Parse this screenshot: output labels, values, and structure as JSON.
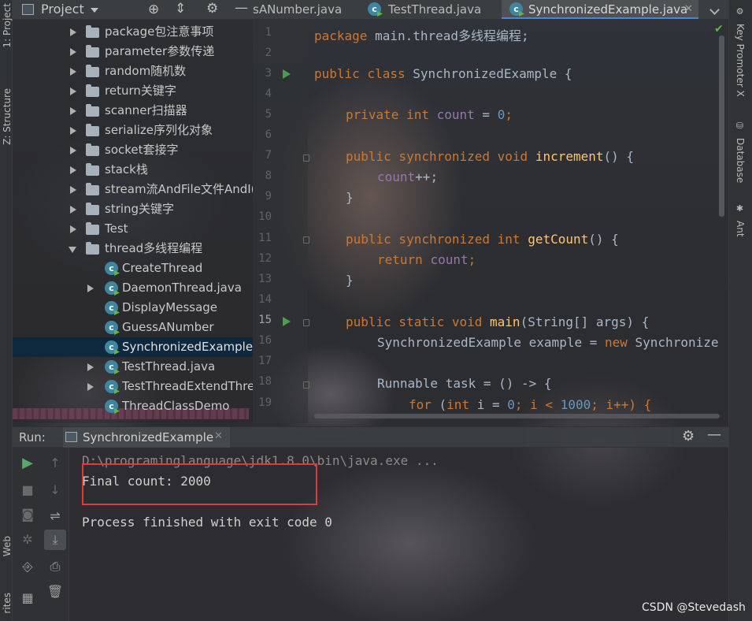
{
  "left_strip": {
    "project_label": "1: Project",
    "structure_label": "Z: Structure",
    "web_label": "Web",
    "favorites_label": "rites"
  },
  "right_strip": {
    "key_promoter_label": "Key Promoter X",
    "database_label": "Database",
    "ant_label": "Ant"
  },
  "project_header": {
    "title": "Project"
  },
  "tabs": [
    {
      "label": "sANumber.java",
      "active": false
    },
    {
      "label": "TestThread.java",
      "active": false
    },
    {
      "label": "SynchronizedExample.java",
      "active": true
    }
  ],
  "tree": {
    "items": [
      {
        "label": "package包注意事项",
        "kind": "folder"
      },
      {
        "label": "parameter参数传递",
        "kind": "folder"
      },
      {
        "label": "random随机数",
        "kind": "folder"
      },
      {
        "label": "return关键字",
        "kind": "folder"
      },
      {
        "label": "scanner扫描器",
        "kind": "folder"
      },
      {
        "label": "serialize序列化对象",
        "kind": "folder"
      },
      {
        "label": "socket套接字",
        "kind": "folder"
      },
      {
        "label": "stack栈",
        "kind": "folder"
      },
      {
        "label": "stream流AndFile文件AndI(",
        "kind": "folder"
      },
      {
        "label": "string关键字",
        "kind": "folder"
      },
      {
        "label": "Test",
        "kind": "folder"
      },
      {
        "label": "thread多线程编程",
        "kind": "folder-open"
      },
      {
        "label": "CreateThread",
        "kind": "class"
      },
      {
        "label": "DaemonThread.java",
        "kind": "class-file"
      },
      {
        "label": "DisplayMessage",
        "kind": "class"
      },
      {
        "label": "GuessANumber",
        "kind": "class"
      },
      {
        "label": "SynchronizedExample",
        "kind": "class",
        "selected": true
      },
      {
        "label": "TestThread.java",
        "kind": "class-file"
      },
      {
        "label": "TestThreadExtendThre",
        "kind": "class-file"
      },
      {
        "label": "ThreadClassDemo",
        "kind": "class"
      }
    ]
  },
  "editor": {
    "line_numbers": [
      "1",
      "2",
      "3",
      "4",
      "5",
      "6",
      "7",
      "8",
      "9",
      "10",
      "11",
      "12",
      "13",
      "14",
      "15",
      "16",
      "17",
      "18",
      "19"
    ],
    "current_line": "15",
    "code": {
      "l1_kw": "package",
      "l1_rest": " main.thread多线程编程;",
      "l3_kw": "public class",
      "l3_rest": " SynchronizedExample {",
      "l5_kw": "private int",
      "l5_field": "count",
      "l5_eq": " = ",
      "l5_num": "0",
      "l5_end": ";",
      "l7_kw": "public synchronized void",
      "l7_fn": "increment",
      "l7_end": "() {",
      "l8_field": "count",
      "l8_end": "++;",
      "l9": "}",
      "l11_kw": "public synchronized int",
      "l11_fn": "getCount",
      "l11_end": "() {",
      "l12_kw": "return",
      "l12_field": "count",
      "l12_end": ";",
      "l13": "}",
      "l15_kw": "public static void",
      "l15_fn": "main",
      "l15_end": "(String[] args) {",
      "l16_a": "SynchronizedExample example = ",
      "l16_kw": "new",
      "l16_b": " Synchronize",
      "l18_a": "Runnable task = () -> {",
      "l19_kw": "for",
      "l19_a": " (",
      "l19_kw2": "int",
      "l19_b": " i = ",
      "l19_n1": "0",
      "l19_c": "; i < ",
      "l19_n2": "1000",
      "l19_d": "; i++) {"
    }
  },
  "run": {
    "label": "Run:",
    "config_name": "SynchronizedExample",
    "console": {
      "command": "D:\\programinglanguage\\jdk1.8.0\\bin\\java.exe ...",
      "output": "Final count: 2000",
      "exit": "Process finished with exit code 0"
    }
  },
  "watermark": "CSDN @Stevedash",
  "colors": {
    "keyword": "#cc7832",
    "function": "#ffc66d",
    "field": "#9876aa",
    "number": "#6897bb",
    "accent": "#4a88c7",
    "highlight_box": "#e03a3a"
  }
}
